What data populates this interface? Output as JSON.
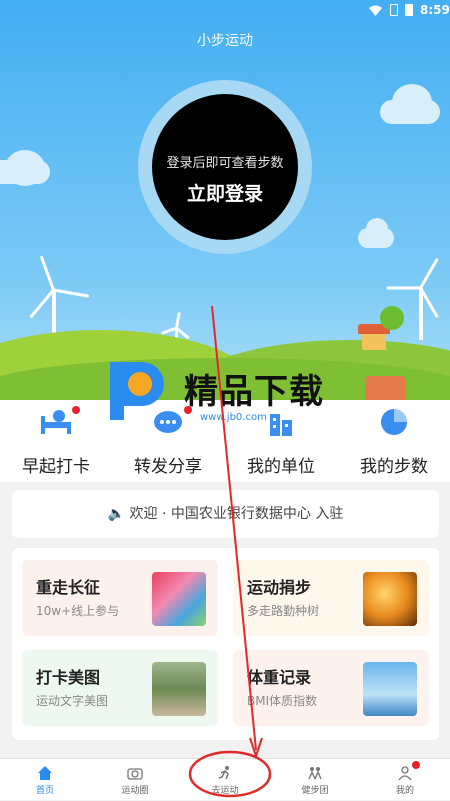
{
  "status_bar": {
    "time": "8:59"
  },
  "header": {
    "title": "小步运动"
  },
  "login_circle": {
    "subtitle": "登录后即可查看步数",
    "button_label": "立即登录"
  },
  "watermark": {
    "text": "精品下载",
    "url": "www.jb0.com"
  },
  "quick_actions": [
    {
      "label": "早起打卡",
      "icon": "alarm-bed-icon",
      "badge": true
    },
    {
      "label": "转发分享",
      "icon": "chat-bubble-icon",
      "badge": true
    },
    {
      "label": "我的单位",
      "icon": "building-icon",
      "badge": false
    },
    {
      "label": "我的步数",
      "icon": "pie-chart-icon",
      "badge": false
    }
  ],
  "notice": {
    "icon": "speaker-icon",
    "text": "欢迎 · 中国农业银行数据中心 入驻"
  },
  "cards": [
    {
      "title": "重走长征",
      "subtitle": "10w+线上参与",
      "bg": "#fdf1ee"
    },
    {
      "title": "运动捐步",
      "subtitle": "多走路勤种树",
      "bg": "#fdf7ec"
    },
    {
      "title": "打卡美图",
      "subtitle": "运动文字美图",
      "bg": "#edf8f1"
    },
    {
      "title": "体重记录",
      "subtitle": "BMI体质指数",
      "bg": "#fdf2ee"
    }
  ],
  "tabbar": [
    {
      "label": "首页",
      "icon": "home-icon",
      "active": true
    },
    {
      "label": "运动圈",
      "icon": "camera-icon",
      "active": false
    },
    {
      "label": "去运动",
      "icon": "runner-icon",
      "active": false
    },
    {
      "label": "健步团",
      "icon": "group-icon",
      "active": false
    },
    {
      "label": "我的",
      "icon": "person-icon",
      "active": false
    }
  ],
  "colors": {
    "accent": "#2b8cf0",
    "badge": "#e8202c",
    "annotation": "#e02a2a"
  }
}
